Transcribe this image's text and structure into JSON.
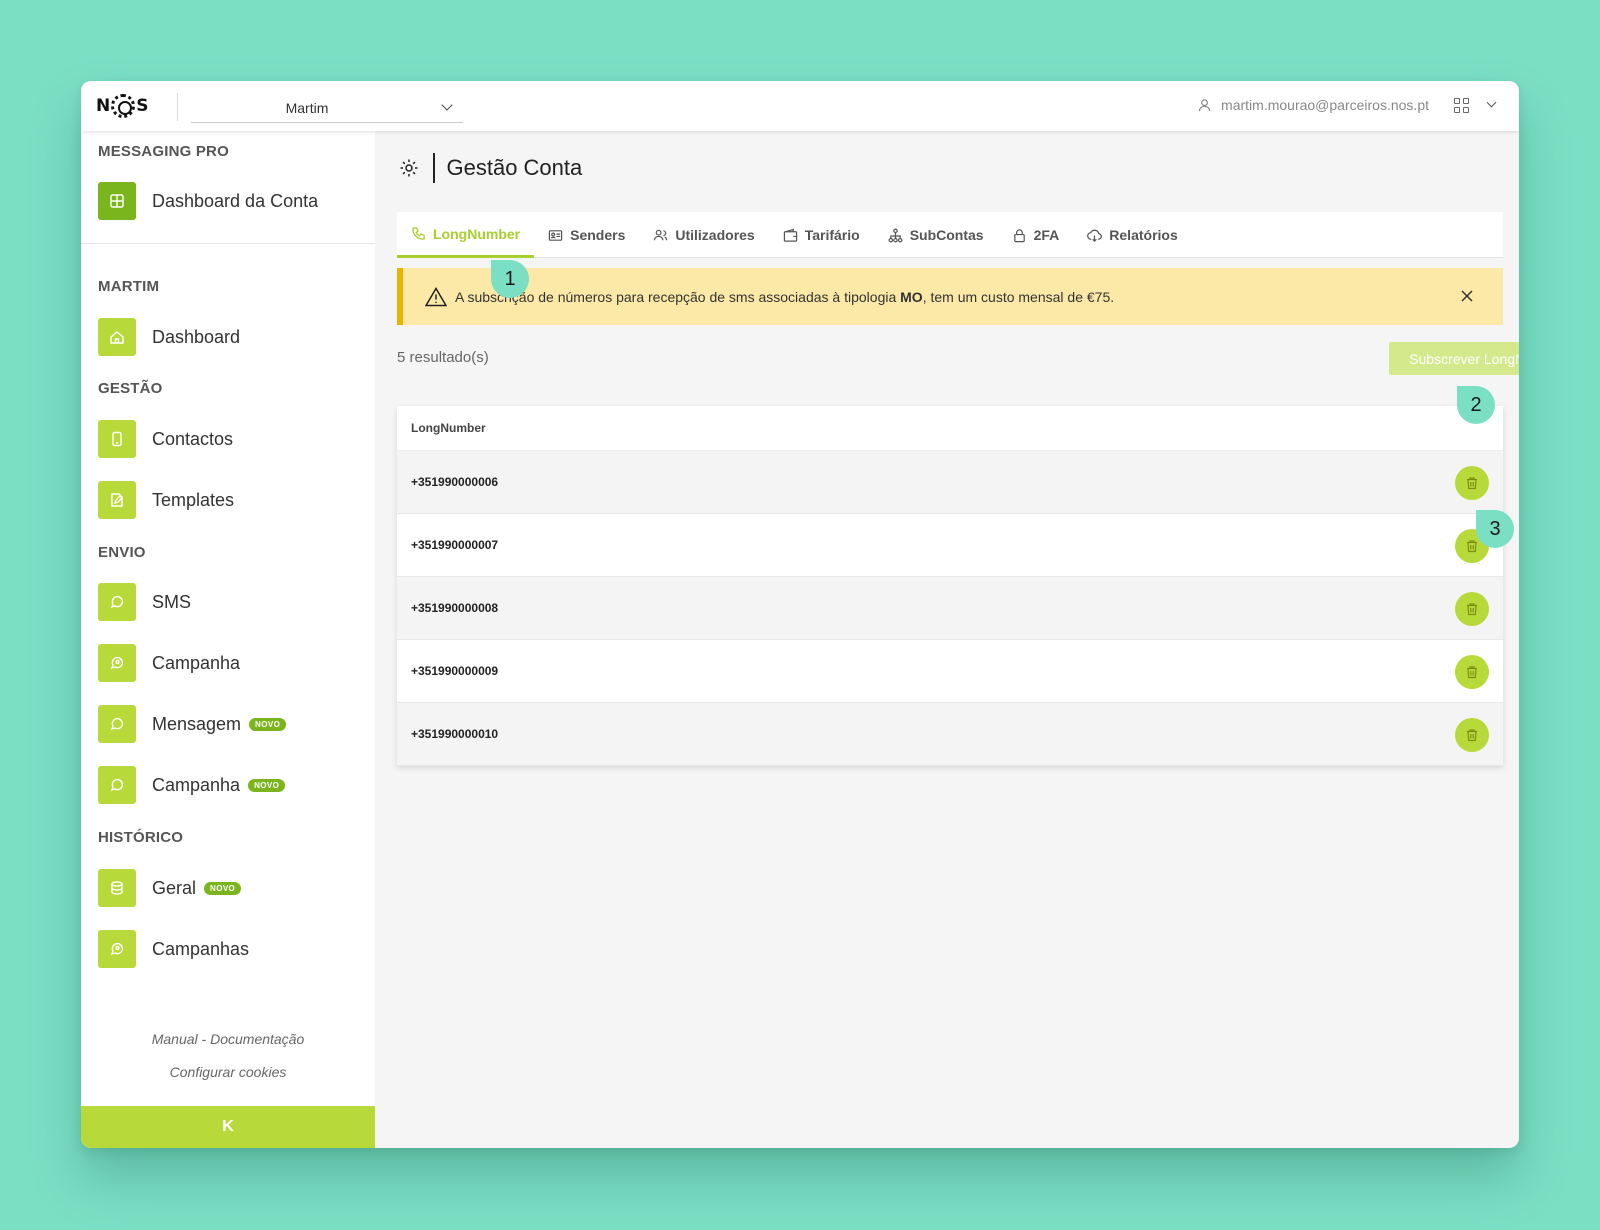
{
  "brand": {
    "logo": "NOS"
  },
  "topbar": {
    "account": "Martim",
    "user_email": "martim.mourao@parceiros.nos.pt"
  },
  "sidebar": {
    "product_title": "MESSAGING PRO",
    "dashboard_conta": "Dashboard da Conta",
    "sections": {
      "martim": "MARTIM",
      "gestao": "GESTÃO",
      "envio": "ENVIO",
      "historico": "HISTÓRICO"
    },
    "items": {
      "dashboard": "Dashboard",
      "contactos": "Contactos",
      "templates": "Templates",
      "sms": "SMS",
      "campanha": "Campanha",
      "mensagem": "Mensagem",
      "campanha_novo": "Campanha",
      "geral": "Geral",
      "campanhas": "Campanhas"
    },
    "badge": "NOVO",
    "footer": {
      "manual": "Manual - Documentação",
      "cookies": "Configurar cookies"
    },
    "collapse": "K"
  },
  "page": {
    "title": "Gestão Conta",
    "tabs": [
      "LongNumber",
      "Senders",
      "Utilizadores",
      "Tarifário",
      "SubContas",
      "2FA",
      "Relatórios"
    ],
    "alert": {
      "prefix": "A subscrição de números para recepção de sms associadas à tipologia ",
      "bold": "MO",
      "suffix": ", tem um custo mensal de €75."
    },
    "results": "5 resultado(s)",
    "subscribe_button": "Subscrever LongNumber",
    "table": {
      "header": "LongNumber",
      "rows": [
        "+351990000006",
        "+351990000007",
        "+351990000008",
        "+351990000009",
        "+351990000010"
      ]
    }
  },
  "markers": [
    "1",
    "2",
    "3"
  ],
  "colors": {
    "background": "#7bdfc4",
    "accent": "#b8d93a",
    "accent_dark": "#7ab51d",
    "alert_bg": "#fce9a8",
    "alert_border": "#e8b400"
  }
}
